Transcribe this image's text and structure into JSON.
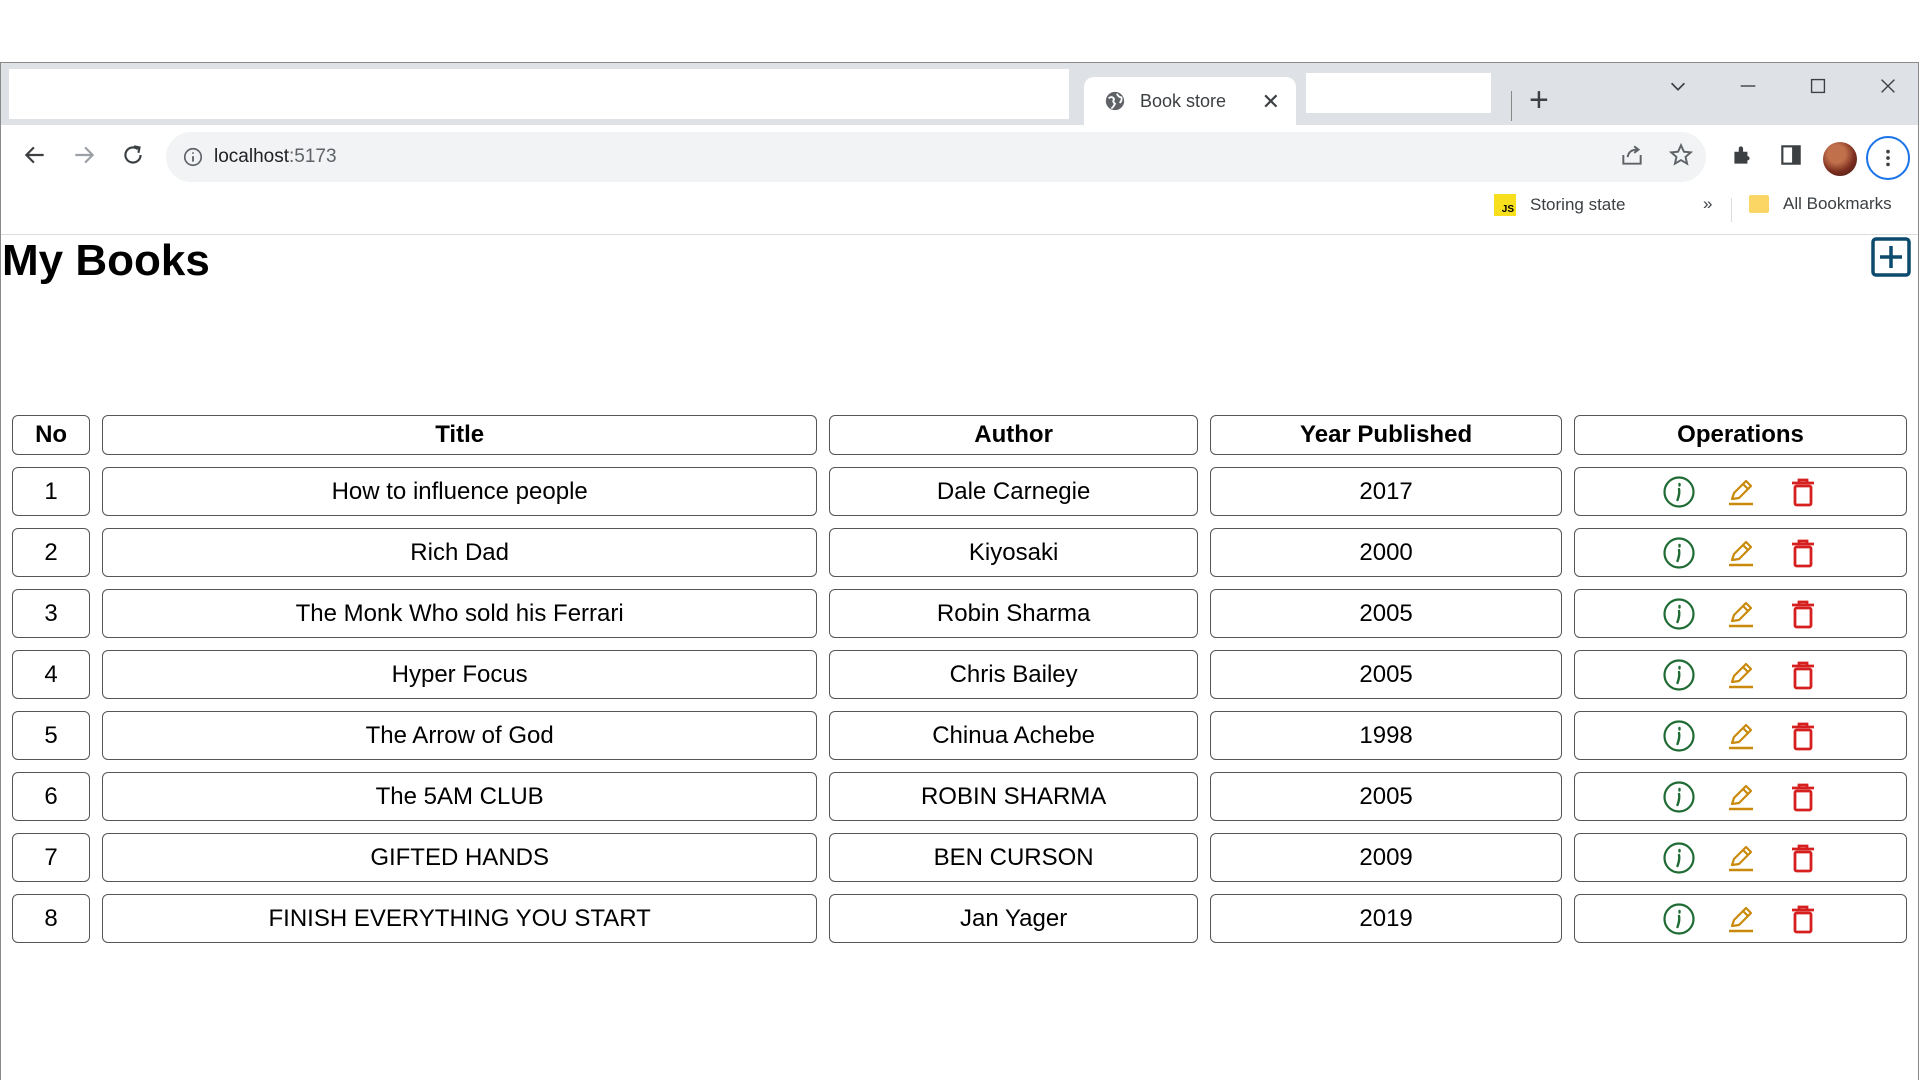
{
  "browser": {
    "tab_title": "Book store",
    "tab_close": "✕",
    "new_tab": "+",
    "url_host": "localhost",
    "url_port": ":5173",
    "window_controls": {
      "dropdown": "⌵",
      "minimize": "—",
      "maximize": "☐",
      "close": "✕"
    },
    "bookmarks": {
      "item1": "Storing state",
      "js_badge": "JS",
      "overflow": "»",
      "all": "All Bookmarks"
    }
  },
  "page": {
    "title": "My Books",
    "add_icon": "plus-square-icon"
  },
  "table": {
    "headers": [
      "No",
      "Title",
      "Author",
      "Year Published",
      "Operations"
    ],
    "rows": [
      {
        "no": "1",
        "title": "How to influence people",
        "author": "Dale Carnegie",
        "year": "2017"
      },
      {
        "no": "2",
        "title": "Rich Dad",
        "author": "Kiyosaki",
        "year": "2000"
      },
      {
        "no": "3",
        "title": "The Monk Who sold his Ferrari",
        "author": "Robin Sharma",
        "year": "2005"
      },
      {
        "no": "4",
        "title": "Hyper Focus",
        "author": "Chris Bailey",
        "year": "2005"
      },
      {
        "no": "5",
        "title": "The Arrow of God",
        "author": "Chinua Achebe",
        "year": "1998"
      },
      {
        "no": "6",
        "title": "The 5AM CLUB",
        "author": "ROBIN SHARMA",
        "year": "2005"
      },
      {
        "no": "7",
        "title": "GIFTED HANDS",
        "author": "BEN CURSON",
        "year": "2009"
      },
      {
        "no": "8",
        "title": "FINISH EVERYTHING YOU START",
        "author": "Jan Yager",
        "year": "2019"
      }
    ],
    "operation_icons": [
      "info-icon",
      "edit-icon",
      "delete-icon"
    ]
  },
  "colors": {
    "info": "#1e6b33",
    "edit": "#c98a0b",
    "delete": "#d62020",
    "add": "#0c4a6e"
  }
}
